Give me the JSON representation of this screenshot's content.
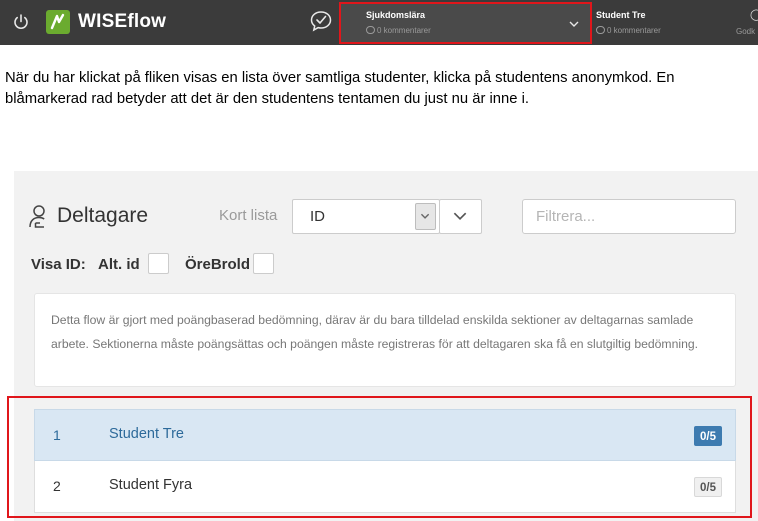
{
  "topbar": {
    "brand": "WISEflow",
    "course": {
      "name": "Sjukdomslära",
      "comments": "0 kommentarer"
    },
    "student": {
      "name": "Student Tre",
      "comments": "0 kommentarer"
    },
    "status": "Godk"
  },
  "instruction": "När du har klickat på fliken visas en lista över samtliga studenter, klicka på studentens anonymkod. En blåmarkerad rad betyder att det är den studentens tentamen du just nu är inne i.",
  "panel": {
    "title": "Deltagare",
    "short_list_label": "Kort lista",
    "sort_value": "ID",
    "filter_placeholder": "Filtrera...",
    "show_id_label": "Visa ID:",
    "id_options": [
      {
        "label": "Alt. id",
        "checked": false
      },
      {
        "label": "ÖreBrold",
        "checked": false
      }
    ],
    "info_text": "Detta flow är gjort med poängbaserad bedömning, därav är du bara tilldelad enskilda sektioner av deltagarnas samlade arbete. Sektionerna måste poängsättas och poängen måste registreras för att deltagaren ska få en slutgiltig bedömning.",
    "participants": [
      {
        "number": "1",
        "name": "Student Tre",
        "score": "0/5",
        "selected": true
      },
      {
        "number": "2",
        "name": "Student Fyra",
        "score": "0/5",
        "selected": false
      }
    ]
  },
  "colors": {
    "topbar_bg": "#3b3b3b",
    "brand_green": "#6bab2f",
    "highlight_red": "#e0161b",
    "selected_row": "#d9e7f3",
    "selected_text": "#2d6a9a",
    "score_active": "#3d7bb0"
  },
  "icons": {
    "power": "power-icon",
    "logo": "wiseflow-logo",
    "comment_check": "comment-check-icon",
    "chevron": "chevron-down-icon",
    "participants": "participants-icon"
  }
}
